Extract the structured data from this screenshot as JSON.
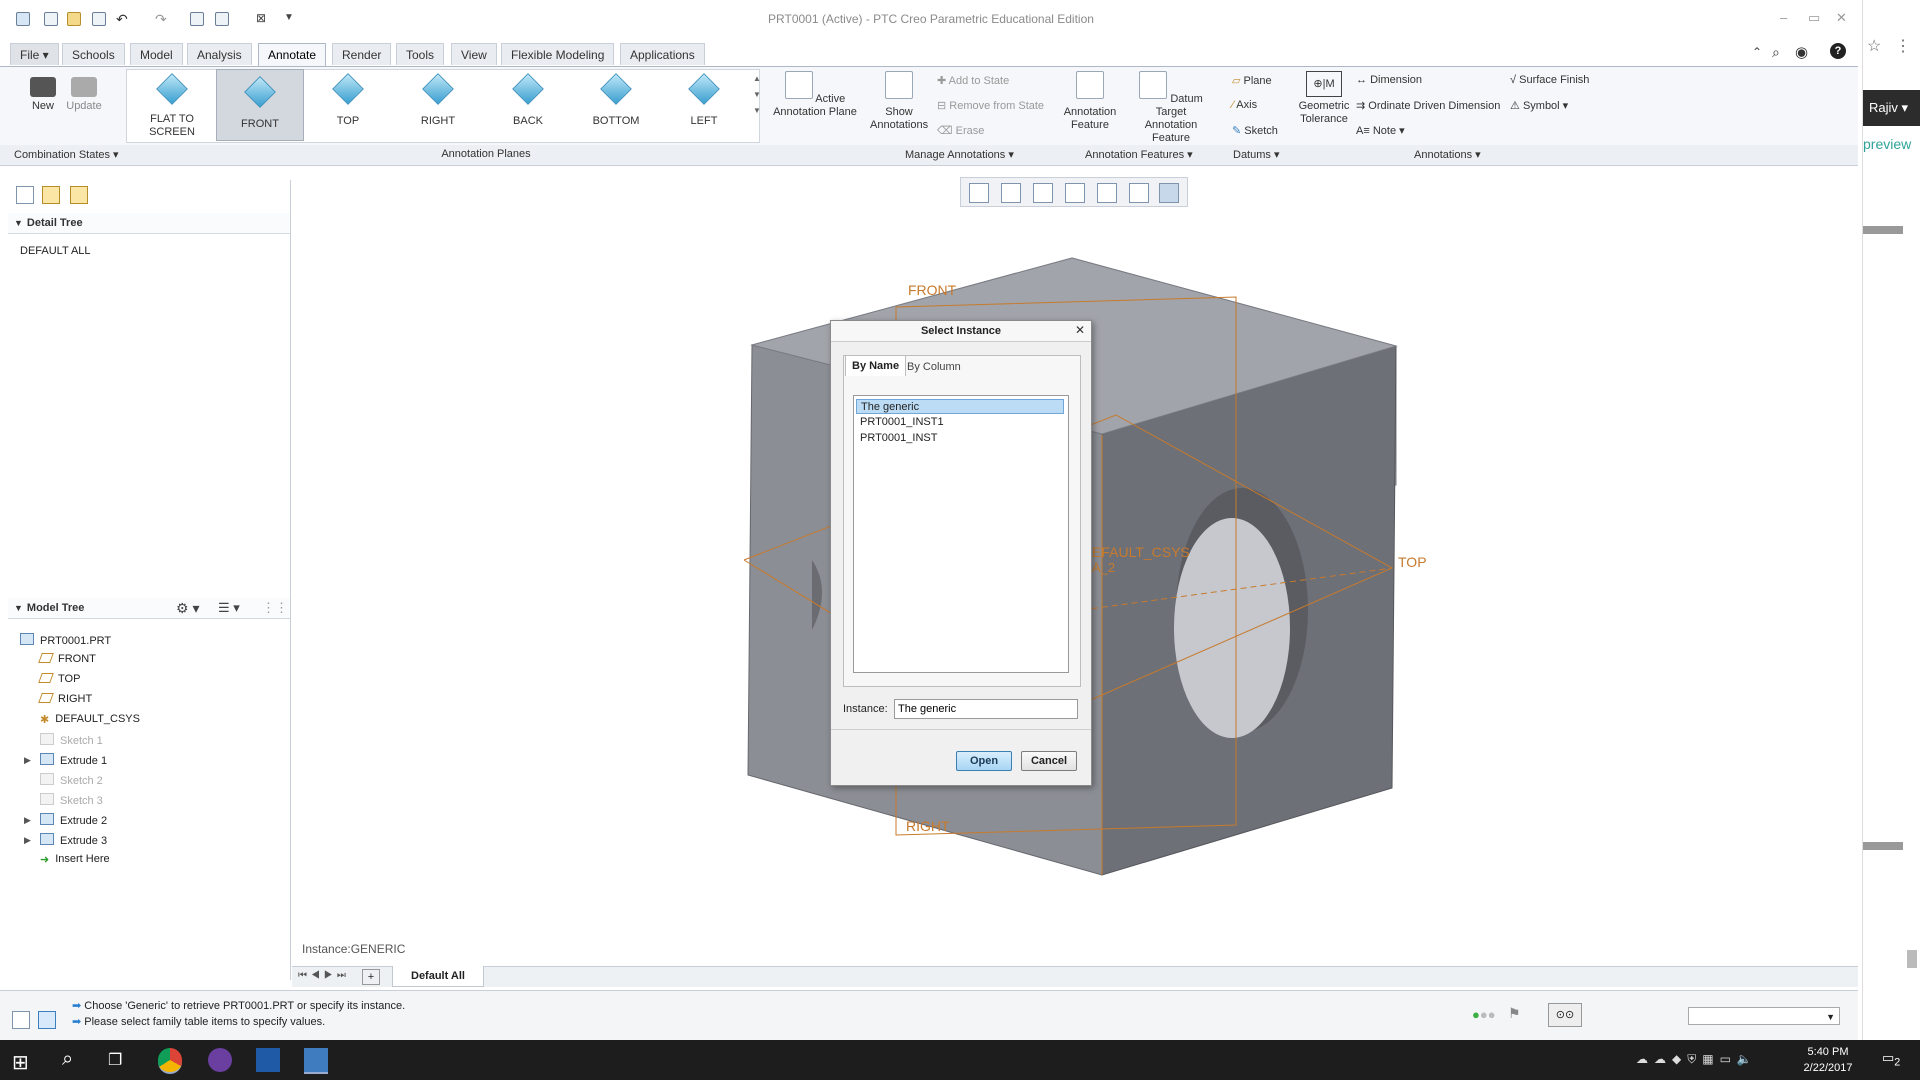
{
  "window": {
    "title": "PRT0001 (Active) - PTC Creo Parametric Educational Edition"
  },
  "menu": {
    "tabs": [
      "File",
      "Schools",
      "Model",
      "Analysis",
      "Annotate",
      "Render",
      "Tools",
      "View",
      "Flexible Modeling",
      "Applications"
    ],
    "active": "Annotate"
  },
  "ribbon": {
    "new": "New",
    "update": "Update",
    "planes": [
      "FLAT TO SCREEN",
      "FRONT",
      "TOP",
      "RIGHT",
      "BACK",
      "BOTTOM",
      "LEFT"
    ],
    "active_annotation_plane": "Active Annotation Plane",
    "show_annotations": "Show Annotations",
    "add_to_state": "Add to State",
    "remove_from_state": "Remove from State",
    "erase": "Erase",
    "annotation_feature": "Annotation Feature",
    "datum_target": "Datum Target Annotation Feature",
    "plane": "Plane",
    "axis": "Axis",
    "sketch": "Sketch",
    "geometric_tolerance": "Geometric Tolerance",
    "dimension": "Dimension",
    "ordinate_dimension": "Ordinate Driven Dimension",
    "note": "Note",
    "surface_finish": "Surface Finish",
    "symbol": "Symbol"
  },
  "groups": {
    "combination_states": "Combination States",
    "annotation_planes": "Annotation Planes",
    "manage_annotations": "Manage Annotations",
    "annotation_features": "Annotation Features",
    "datums": "Datums",
    "annotations": "Annotations"
  },
  "detail_tree": {
    "header": "Detail Tree",
    "items": [
      "DEFAULT ALL"
    ]
  },
  "model_tree": {
    "header": "Model Tree",
    "items": [
      "PRT0001.PRT",
      "FRONT",
      "TOP",
      "RIGHT",
      "DEFAULT_CSYS",
      "Sketch 1",
      "Extrude 1",
      "Sketch 2",
      "Sketch 3",
      "Extrude 2",
      "Extrude 3",
      "Insert Here"
    ]
  },
  "graphics": {
    "labels": {
      "front": "FRONT",
      "top": "TOP",
      "right": "RIGHT",
      "csys": "EFAULT_CSYS",
      "axis": "A_2"
    },
    "instance_text": "Instance:GENERIC"
  },
  "dialog": {
    "title": "Select Instance",
    "tabs": [
      "By Name",
      "By Column"
    ],
    "items": [
      "The generic",
      "PRT0001_INST1",
      "PRT0001_INST"
    ],
    "selected": "The generic",
    "instance_label": "Instance:",
    "instance_value": "The generic",
    "open": "Open",
    "cancel": "Cancel"
  },
  "bottom": {
    "tab": "Default All"
  },
  "status": {
    "line1": "Choose 'Generic' to retrieve PRT0001.PRT or specify its instance.",
    "line2": "Please select family table items to specify values."
  },
  "side": {
    "user": "Rajiv",
    "preview": "preview"
  },
  "taskbar": {
    "time": "5:40 PM",
    "date": "2/22/2017",
    "notification_count": "2"
  }
}
